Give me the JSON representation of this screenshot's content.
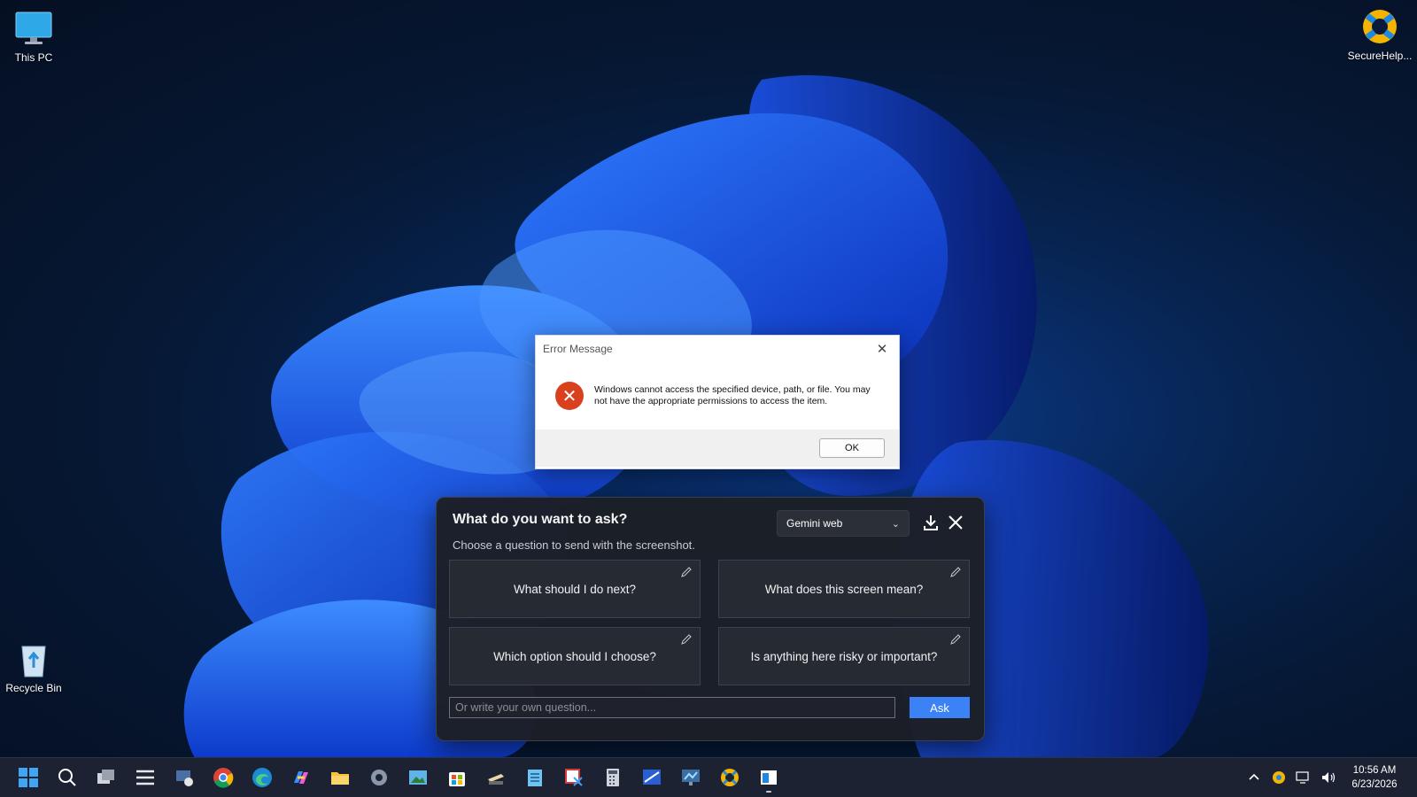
{
  "desktop": {
    "icons": [
      {
        "label": "This PC",
        "icon": "monitor-icon"
      },
      {
        "label": "SecureHelp...",
        "icon": "lifebuoy-icon"
      },
      {
        "label": "Recycle Bin",
        "icon": "recycle-bin-icon"
      }
    ]
  },
  "error_dialog": {
    "title": "Error Message",
    "message": "Windows cannot access the specified device, path, or file. You may not have the appropriate permissions to access the item.",
    "ok_label": "OK",
    "icon": "error-icon"
  },
  "ask_panel": {
    "heading": "What do you want to ask?",
    "subheading": "Choose a question to send with the screenshot.",
    "model_selected": "Gemini web",
    "questions": [
      {
        "label": "What should I do next?"
      },
      {
        "label": "What does this screen mean?"
      },
      {
        "label": "Which option should I choose?"
      },
      {
        "label": "Is anything here risky or important?"
      }
    ],
    "own_question_placeholder": "Or write your own question...",
    "ask_label": "Ask"
  },
  "taskbar": {
    "apps": [
      "start-icon",
      "search-icon",
      "task-view-icon",
      "menu-icon",
      "remote-desktop-icon",
      "chrome-icon",
      "edge-icon",
      "copilot-icon",
      "file-explorer-icon",
      "settings-icon",
      "photos-icon",
      "store-icon",
      "scanner-icon",
      "notepad-icon",
      "snipping-tool-icon",
      "calculator-icon",
      "paint-icon",
      "monitor-app-icon",
      "securehelp-icon",
      "window-app-icon"
    ],
    "clock_time": "10:56 AM",
    "clock_date": "6/23/2026"
  },
  "colors": {
    "accent": "#3b82f6",
    "error": "#d9411e",
    "taskbar": "#1c2231"
  }
}
